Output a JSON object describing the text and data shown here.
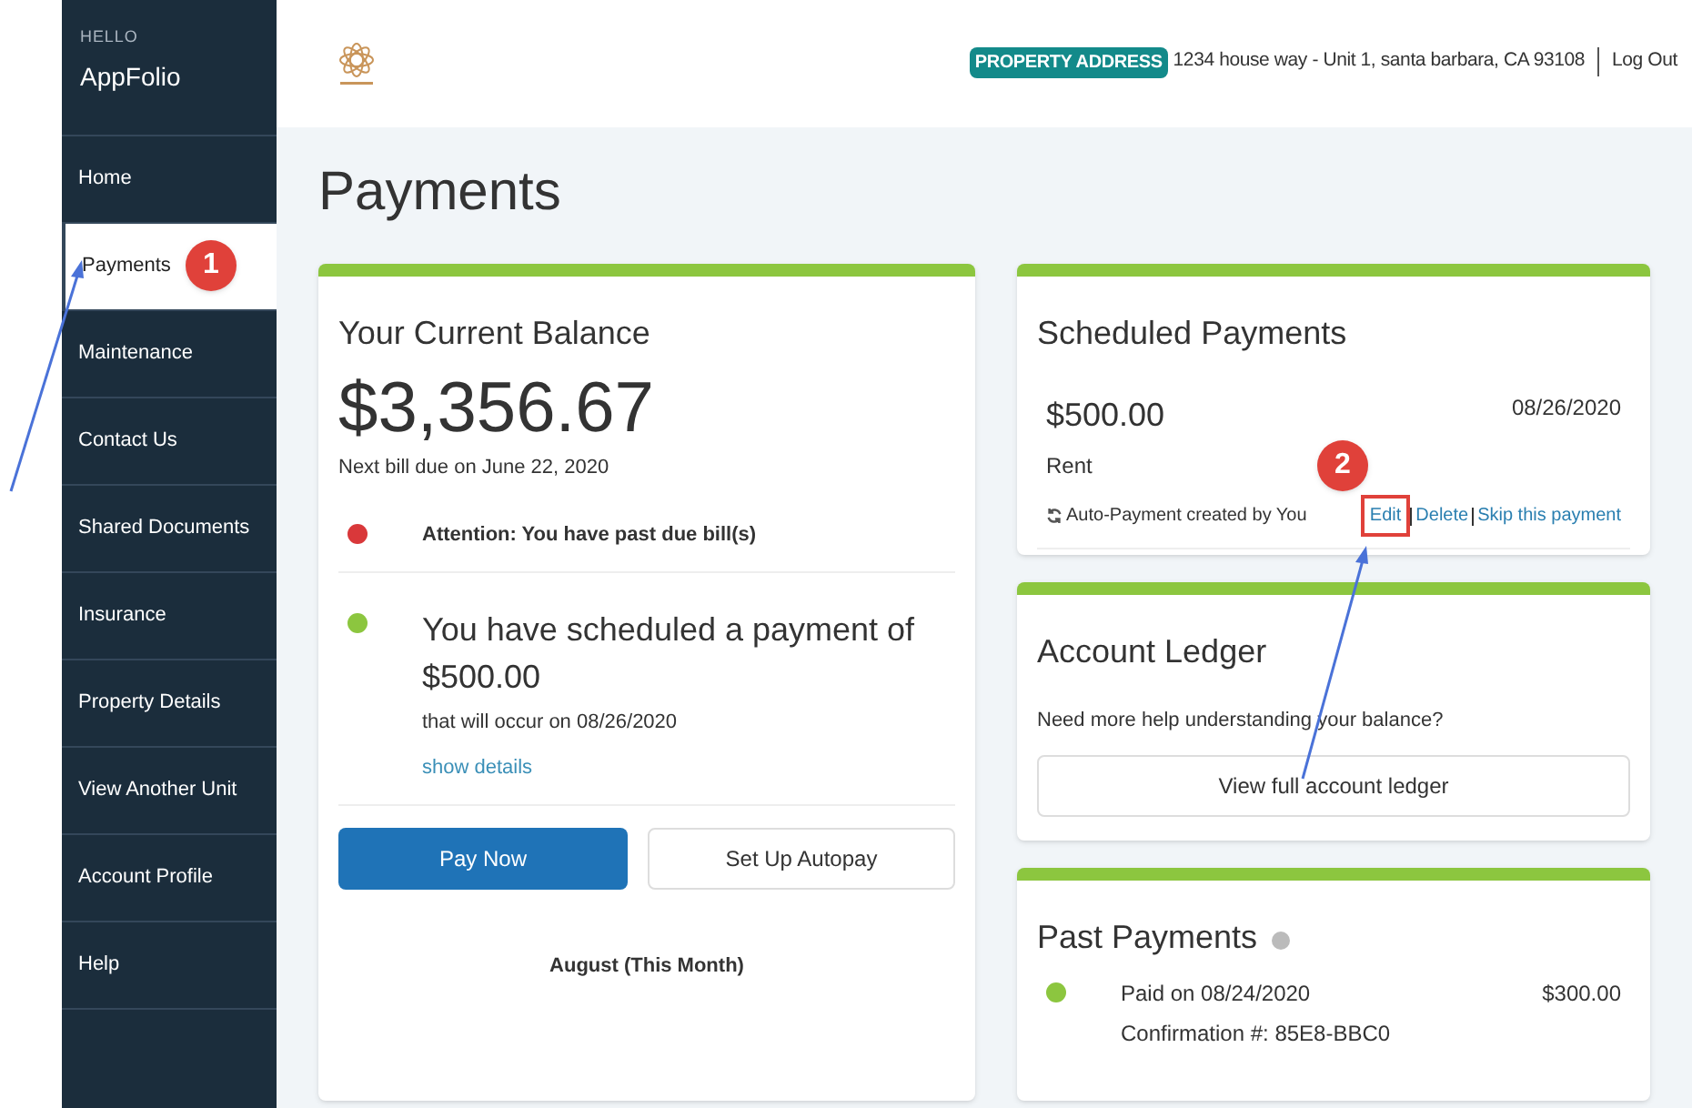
{
  "sidebar": {
    "greeting": "HELLO",
    "user": "AppFolio",
    "items": [
      {
        "label": "Home",
        "selected": false
      },
      {
        "label": "Payments",
        "selected": true
      },
      {
        "label": "Maintenance",
        "selected": false
      },
      {
        "label": "Contact Us",
        "selected": false
      },
      {
        "label": "Shared Documents",
        "selected": false
      },
      {
        "label": "Insurance",
        "selected": false
      },
      {
        "label": "Property Details",
        "selected": false
      },
      {
        "label": "View Another Unit",
        "selected": false
      },
      {
        "label": "Account Profile",
        "selected": false
      },
      {
        "label": "Help",
        "selected": false
      }
    ]
  },
  "header": {
    "address_label": "PROPERTY ADDRESS",
    "address": "1234 house way - Unit 1, santa barbara, CA 93108",
    "logout": "Log Out"
  },
  "page_title": "Payments",
  "balance_card": {
    "title": "Your Current Balance",
    "amount": "$3,356.67",
    "next_bill": "Next bill due on June 22, 2020",
    "notices": [
      {
        "color": "#d9383a",
        "kind": "alert",
        "text": "Attention: You have past due bill(s)"
      },
      {
        "color": "#8cc63f",
        "kind": "scheduled",
        "text": "You have scheduled a payment of",
        "amount": "$500.00",
        "detail": "that will occur on 08/26/2020",
        "link": "show details"
      }
    ],
    "pay_button": "Pay Now",
    "autopay_button": "Set Up Autopay",
    "month_label": "August (This Month)"
  },
  "scheduled_card": {
    "title": "Scheduled Payments",
    "amount": "$500.00",
    "date": "08/26/2020",
    "category": "Rent",
    "note": "Auto-Payment created by You",
    "actions": [
      "Edit",
      "Delete",
      "Skip this payment"
    ]
  },
  "ledger_card": {
    "title": "Account Ledger",
    "text": "Need more help understanding your balance?",
    "button": "View full account ledger"
  },
  "past_card": {
    "title": "Past Payments",
    "payments": [
      {
        "color": "#8cc63f",
        "paid": "Paid on 08/24/2020",
        "confirmation": "Confirmation #: 85E8-BBC0",
        "amount": "$300.00"
      }
    ]
  },
  "annotations": [
    {
      "label": "1"
    },
    {
      "label": "2"
    }
  ]
}
